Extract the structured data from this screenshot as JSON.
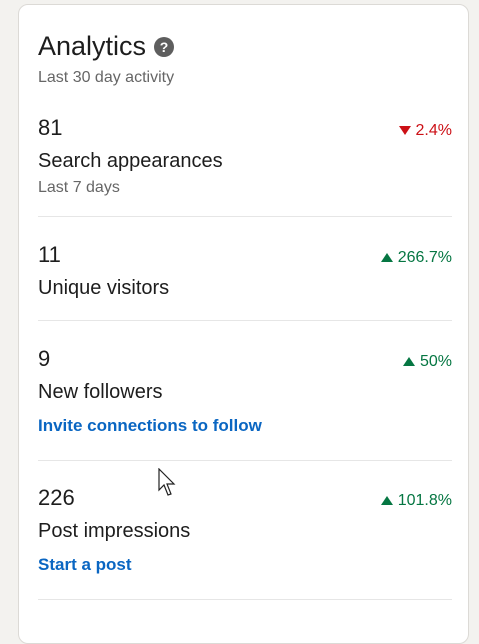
{
  "analytics": {
    "title": "Analytics",
    "subtitle": "Last 30 day activity",
    "metrics": [
      {
        "value": "81",
        "label": "Search appearances",
        "change": "2.4%",
        "direction": "down",
        "meta": "Last 7 days"
      },
      {
        "value": "11",
        "label": "Unique visitors",
        "change": "266.7%",
        "direction": "up"
      },
      {
        "value": "9",
        "label": "New followers",
        "change": "50%",
        "direction": "up",
        "link": "Invite connections to follow"
      },
      {
        "value": "226",
        "label": "Post impressions",
        "change": "101.8%",
        "direction": "up",
        "link": "Start a post"
      }
    ]
  },
  "icons": {
    "help": "help-icon",
    "cursor": "mouse-pointer-icon"
  },
  "colors": {
    "accent_link": "#0a66c2",
    "increase": "#057642",
    "decrease": "#cc1016"
  }
}
